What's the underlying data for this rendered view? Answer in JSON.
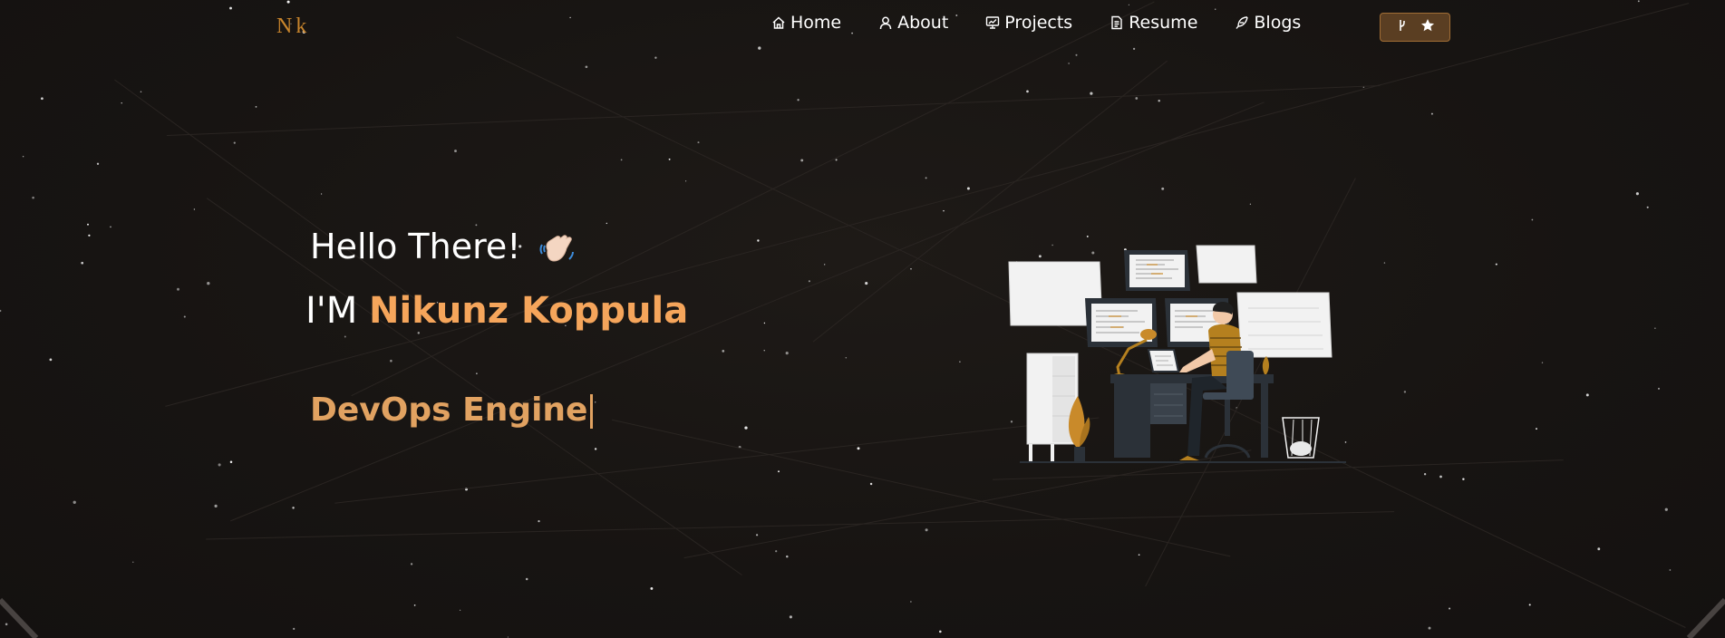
{
  "brand": {
    "text": "Nk"
  },
  "nav": {
    "items": [
      {
        "label": "Home",
        "icon": "home-icon"
      },
      {
        "label": "About",
        "icon": "user-icon"
      },
      {
        "label": "Projects",
        "icon": "projects-icon"
      },
      {
        "label": "Resume",
        "icon": "document-icon"
      },
      {
        "label": "Blogs",
        "icon": "feather-icon"
      }
    ],
    "fork_button": {
      "icons": [
        "git-fork-icon",
        "star-icon"
      ]
    }
  },
  "hero": {
    "greeting": "Hello There!",
    "greeting_emoji": "waving-hand-icon",
    "intro_prefix": "I'M",
    "name": "Nikunz Koppula",
    "typed_role": "DevOps Engine"
  },
  "colors": {
    "accent": "#f5a55b",
    "role": "#e1a261",
    "brand": "#c8852c",
    "background": "#1a1715",
    "fork_button_bg": "#5a3e22"
  }
}
